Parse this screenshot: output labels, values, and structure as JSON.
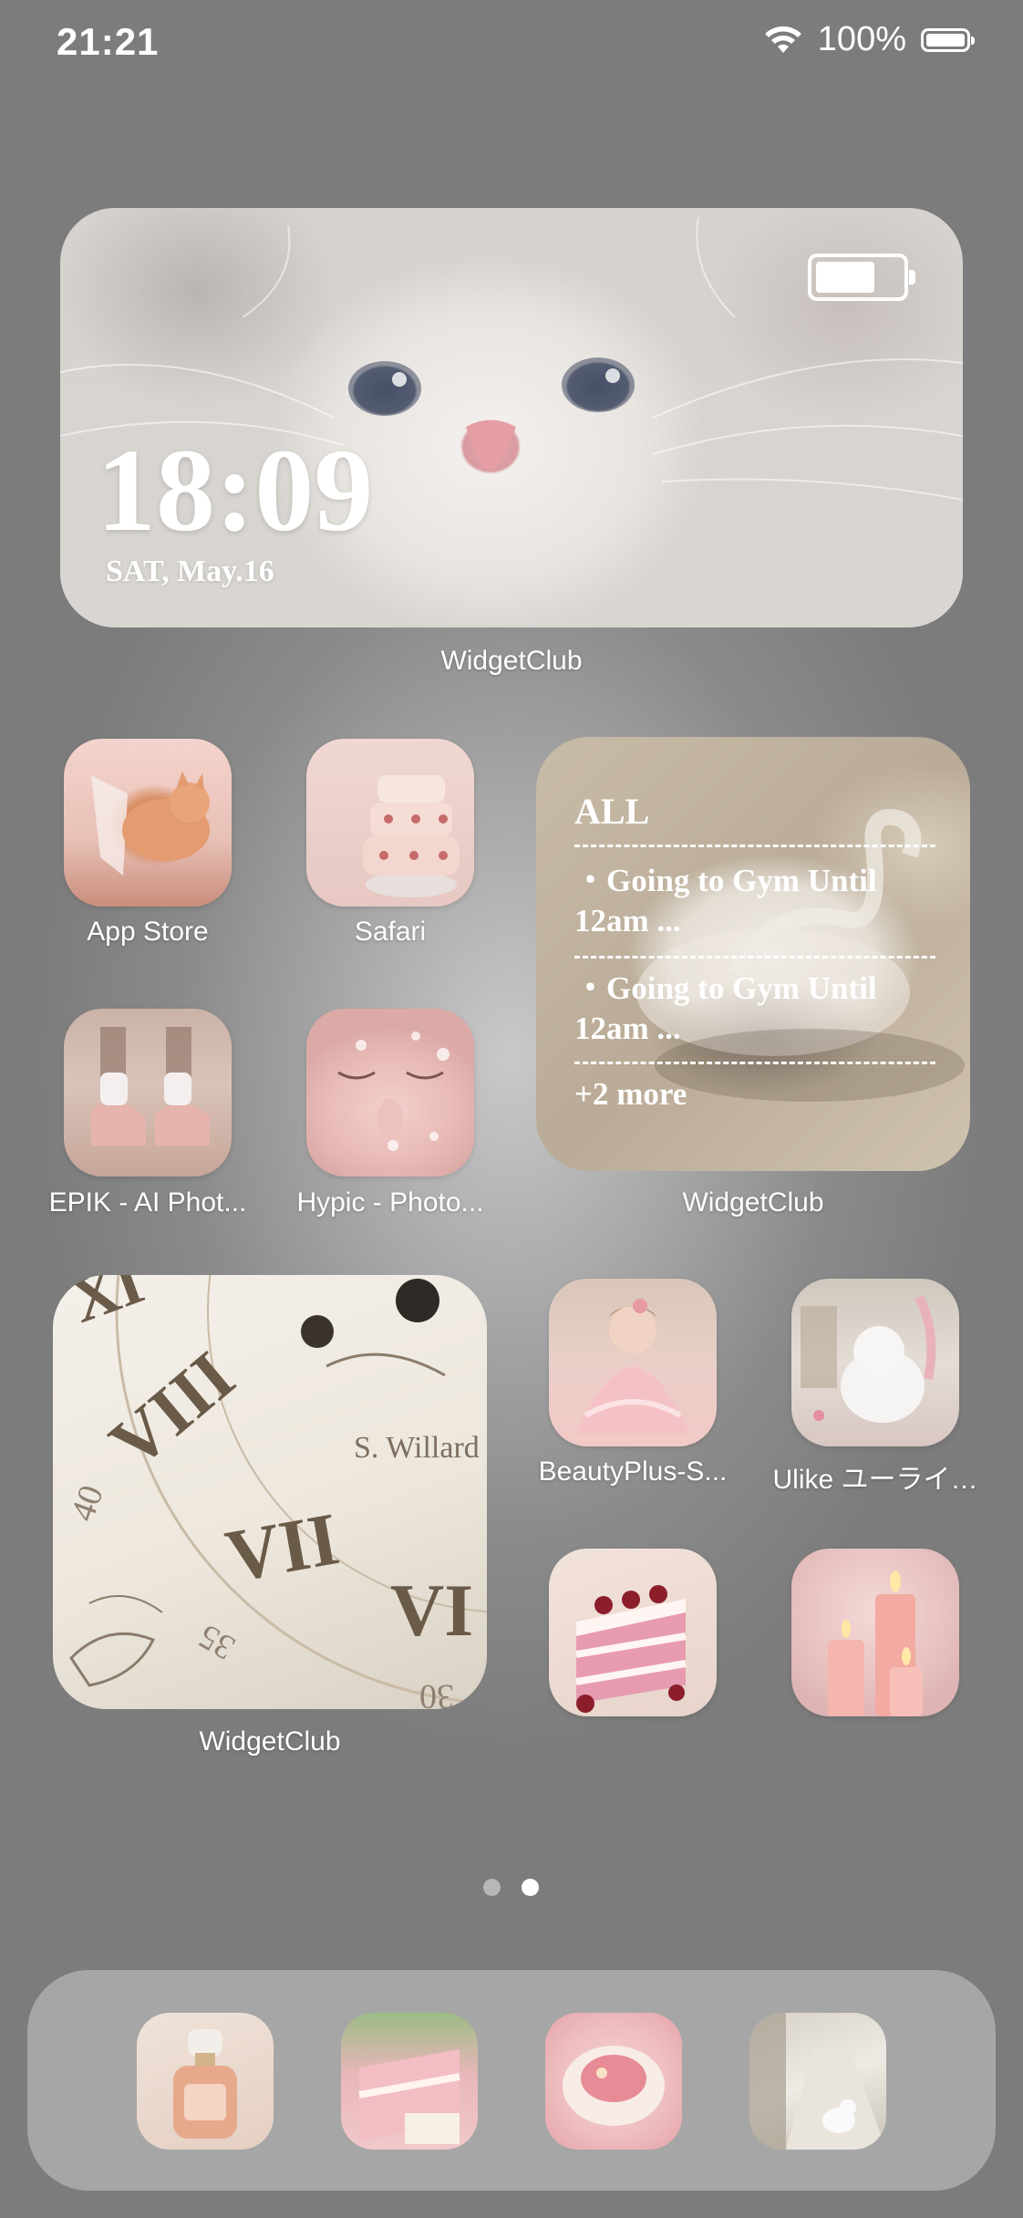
{
  "status_bar": {
    "time": "21:21",
    "battery_text": "100%"
  },
  "widget_clock_cat": {
    "time": "18:09",
    "date": "SAT, May.16",
    "label": "WidgetClub"
  },
  "apps": {
    "app_store": {
      "label": "App Store"
    },
    "safari": {
      "label": "Safari"
    },
    "epik": {
      "label": "EPIK - AI Phot..."
    },
    "hypic": {
      "label": "Hypic - Photo..."
    },
    "beautyplus": {
      "label": "BeautyPlus-S..."
    },
    "ulike": {
      "label": "Ulike ユーライ…"
    }
  },
  "widget_todo": {
    "header": "ALL",
    "items": [
      "・Going to Gym Until 12am ...",
      "・Going to Gym Until 12am ..."
    ],
    "more": "+2 more",
    "label": "WidgetClub"
  },
  "widget_clock_face": {
    "brand": "S. Willard",
    "label": "WidgetClub"
  },
  "page_indicator": {
    "count": 2,
    "active": 2
  },
  "colors": {
    "background": "#8a8a8a",
    "dock": "#c8c8c8",
    "accent_pink": "#e8b4b0"
  },
  "icons": {
    "status": [
      "wifi-icon",
      "battery-icon"
    ],
    "dock": [
      "perfume-icon",
      "cake-icon",
      "teacup-icon",
      "alley-cat-icon"
    ]
  }
}
